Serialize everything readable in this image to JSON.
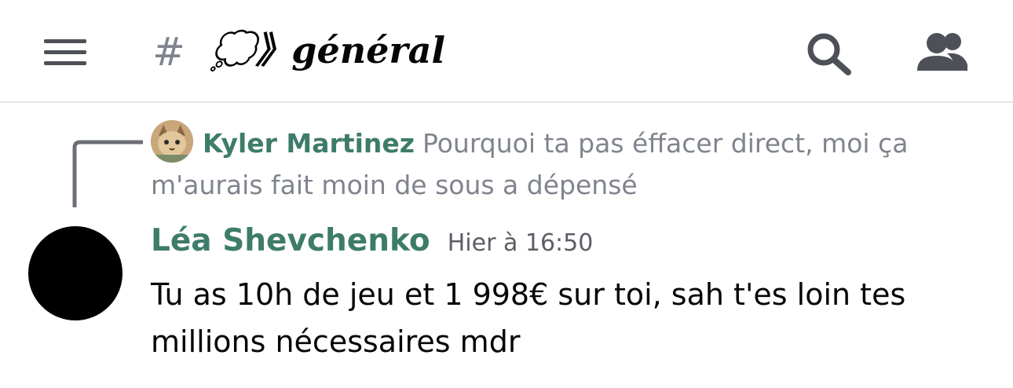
{
  "header": {
    "hash": "#",
    "channel_name": "💭》𝒈é𝒏é𝒓𝒂𝒍",
    "icons": {
      "menu": "hamburger-menu-icon",
      "search": "search-icon",
      "members": "members-icon"
    }
  },
  "reply": {
    "author": "Kyler Martinez",
    "text": "Pourquoi ta pas éffacer direct, moi ça m'aurais fait moin de sous a dépensé"
  },
  "message": {
    "author": "Léa Shevchenko",
    "timestamp": "Hier à 16:50",
    "text": "Tu as 10h de jeu et 1 998€ sur toi, sah t'es loin tes millions nécessaires mdr"
  },
  "colors": {
    "accent_author": "#3e7c6a",
    "muted_text": "#80848e",
    "icon": "#4e5058",
    "divider": "#e3e5e8"
  }
}
